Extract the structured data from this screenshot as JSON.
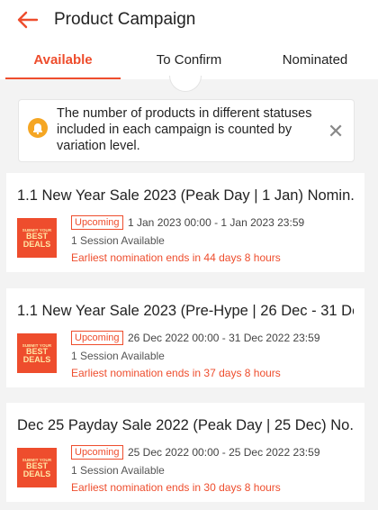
{
  "header": {
    "back_icon": "arrow-left-icon",
    "title": "Product Campaign",
    "accent_color": "#ee4d2d"
  },
  "tabs": [
    {
      "label": "Available",
      "active": true
    },
    {
      "label": "To Confirm",
      "active": false
    },
    {
      "label": "Nominated",
      "active": false
    }
  ],
  "notice": {
    "icon": "bell-icon",
    "text": "The number of products in different statuses included in each campaign is counted by variation level.",
    "close_icon": "close-icon"
  },
  "campaigns": [
    {
      "title": "1.1 New Year Sale 2023 (Peak Day | 1 Jan) Nomin...",
      "image_text_small": "SUBMIT YOUR",
      "image_text_big_1": "BEST",
      "image_text_big_2": "DEALS",
      "status": "Upcoming",
      "date_range": "1 Jan 2023 00:00 - 1 Jan 2023 23:59",
      "session": "1 Session Available",
      "deadline": "Earliest nomination ends in 44 days 8 hours"
    },
    {
      "title": "1.1 New Year Sale 2023 (Pre-Hype | 26 Dec - 31 De...",
      "image_text_small": "SUBMIT YOUR",
      "image_text_big_1": "BEST",
      "image_text_big_2": "DEALS",
      "status": "Upcoming",
      "date_range": "26 Dec 2022 00:00 - 31 Dec 2022 23:59",
      "session": "1 Session Available",
      "deadline": "Earliest nomination ends in 37 days 8 hours"
    },
    {
      "title": "Dec 25 Payday Sale 2022 (Peak Day | 25 Dec) No...",
      "image_text_small": "SUBMIT YOUR",
      "image_text_big_1": "BEST",
      "image_text_big_2": "DEALS",
      "status": "Upcoming",
      "date_range": "25 Dec 2022 00:00 - 25 Dec 2022 23:59",
      "session": "1 Session Available",
      "deadline": "Earliest nomination ends in 30 days 8 hours"
    }
  ]
}
